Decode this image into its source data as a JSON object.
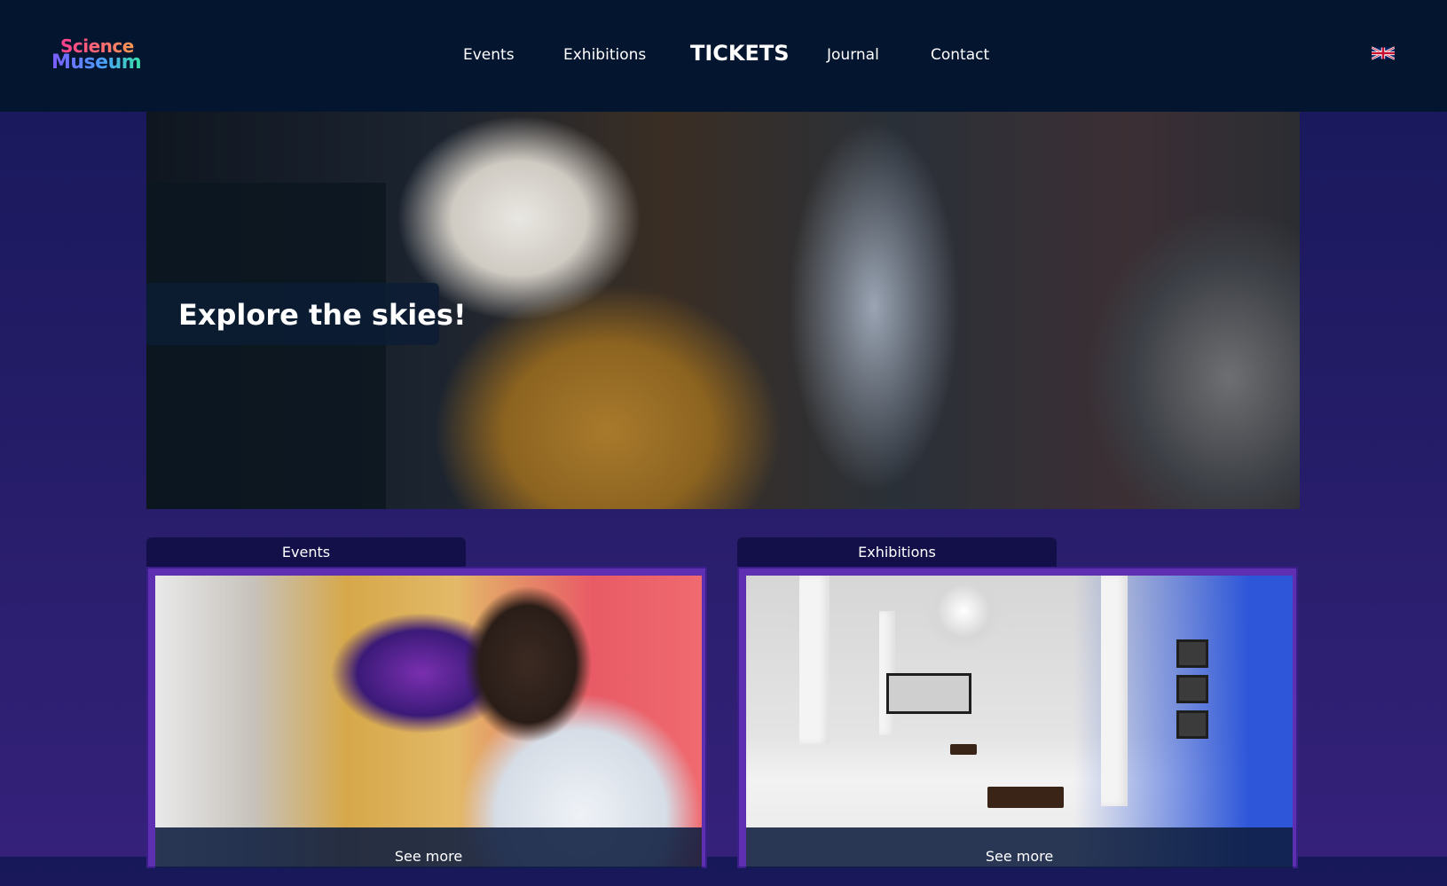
{
  "header": {
    "logo_line1": "Science",
    "logo_line2": "Museum",
    "nav": [
      "Events",
      "Exhibitions",
      "TICKETS",
      "Journal",
      "Contact"
    ],
    "language_icon": "uk-flag-icon"
  },
  "hero": {
    "caption": "Explore the skies!"
  },
  "cards": [
    {
      "tab": "Events",
      "cta": "See more"
    },
    {
      "tab": "Exhibitions",
      "cta": "See more"
    }
  ],
  "colors": {
    "header_bg": "#04152f",
    "page_bg_top": "#17185a",
    "page_bg_bottom": "#35217a",
    "card_border": "#5f2fb1",
    "tab_bg": "#131049"
  }
}
